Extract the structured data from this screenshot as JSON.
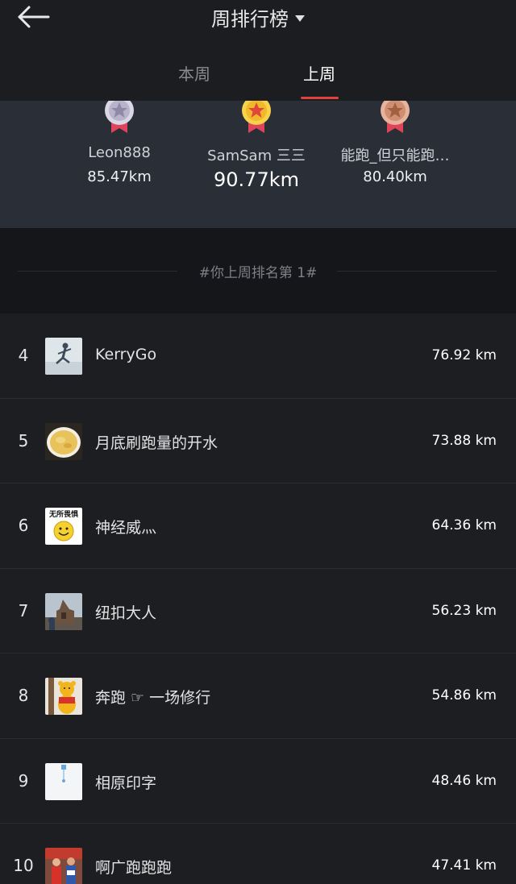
{
  "header": {
    "title": "周排行榜",
    "back_icon": "arrow-left-icon",
    "dropdown_icon": "caret-down-icon"
  },
  "tabs": [
    {
      "label": "本周",
      "active": false
    },
    {
      "label": "上周",
      "active": true
    }
  ],
  "podium": [
    {
      "rank": 2,
      "name": "Leon888",
      "distance": "85.47km",
      "medal": "silver-medal-icon"
    },
    {
      "rank": 1,
      "name": "SamSam 三三",
      "distance": "90.77km",
      "medal": "gold-medal-icon"
    },
    {
      "rank": 3,
      "name": "能跑_但只能跑…",
      "distance": "80.40km",
      "medal": "bronze-medal-icon"
    }
  ],
  "banner": {
    "text": "#你上周排名第 1#"
  },
  "leaderboard": [
    {
      "rank": "4",
      "name": "KerryGo",
      "distance": "76.92 km"
    },
    {
      "rank": "5",
      "name": "月底刷跑量的开水",
      "distance": "73.88 km"
    },
    {
      "rank": "6",
      "name": "神经威灬",
      "distance": "64.36 km"
    },
    {
      "rank": "7",
      "name": "纽扣大人",
      "distance": "56.23 km"
    },
    {
      "rank": "8",
      "name": "奔跑 ☞ 一场修行",
      "distance": "54.86 km"
    },
    {
      "rank": "9",
      "name": "相原印字",
      "distance": "48.46 km"
    },
    {
      "rank": "10",
      "name": "啊广跑跑跑",
      "distance": "47.41 km"
    }
  ],
  "avatar_text": {
    "row6": "无所畏惧"
  },
  "colors": {
    "accent": "#e0413f",
    "gold": "#f2c230",
    "silver": "#c9c6d6",
    "bronze": "#d99a7e"
  }
}
